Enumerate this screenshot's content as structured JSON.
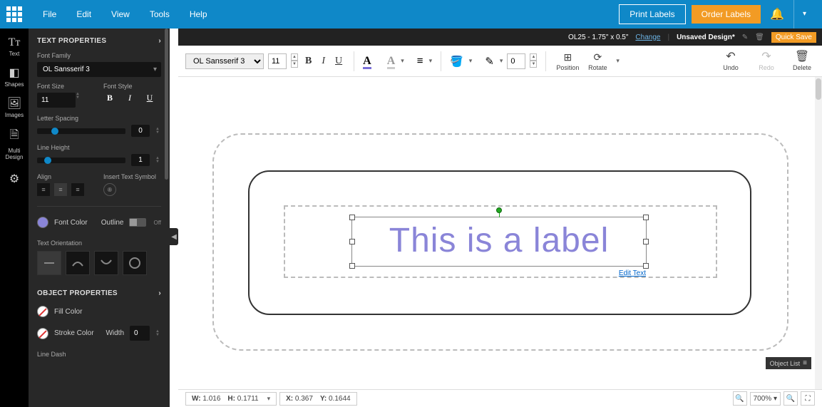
{
  "header": {
    "menu": [
      "File",
      "Edit",
      "View",
      "Tools",
      "Help"
    ],
    "print_labels": "Print Labels",
    "order_labels": "Order Labels"
  },
  "sidebar_tools": {
    "text": "Text",
    "shapes": "Shapes",
    "images": "Images",
    "multi": "Multi Design"
  },
  "info": {
    "product": "OL25 - 1.75\" x 0.5\"",
    "change": "Change",
    "design_name": "Unsaved Design*",
    "quick_save": "Quick Save"
  },
  "toolbar": {
    "font_family": "OL Sansserif 3",
    "font_size": "11",
    "stroke_width": "0",
    "position": "Position",
    "rotate": "Rotate",
    "undo": "Undo",
    "redo": "Redo",
    "delete": "Delete"
  },
  "text_props": {
    "title": "TEXT PROPERTIES",
    "font_family_label": "Font Family",
    "font_family_value": "OL Sansserif 3",
    "font_size_label": "Font Size",
    "font_size_value": "11",
    "font_style_label": "Font Style",
    "letter_spacing_label": "Letter Spacing",
    "letter_spacing_value": "0",
    "line_height_label": "Line Height",
    "line_height_value": "1",
    "align_label": "Align",
    "insert_symbol_label": "Insert Text Symbol",
    "font_color_label": "Font Color",
    "outline_label": "Outline",
    "outline_state": "Off",
    "orientation_label": "Text Orientation"
  },
  "obj_props": {
    "title": "OBJECT PROPERTIES",
    "fill_color_label": "Fill Color",
    "stroke_color_label": "Stroke Color",
    "width_label": "Width",
    "width_value": "0",
    "line_dash_label": "Line Dash"
  },
  "canvas": {
    "text_content": "This is a label",
    "edit_text": "Edit Text"
  },
  "status": {
    "w_label": "W:",
    "w_val": "1.016",
    "h_label": "H:",
    "h_val": "0.1711",
    "x_label": "X:",
    "x_val": "0.367",
    "y_label": "Y:",
    "y_val": "0.1644",
    "zoom": "700%",
    "object_list": "Object List"
  }
}
